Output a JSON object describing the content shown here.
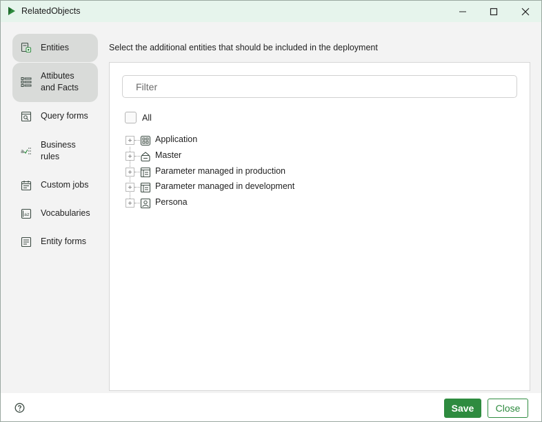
{
  "window": {
    "title": "RelatedObjects",
    "logo_icon": "app-logo-icon",
    "controls": {
      "minimize_icon": "minimize-icon",
      "maximize_icon": "maximize-icon",
      "close_icon": "close-window-icon"
    }
  },
  "sidebar": {
    "items": [
      {
        "label": "Entities",
        "icon": "entities-icon",
        "active": true
      },
      {
        "label": "Attibutes\nand Facts",
        "icon": "attributes-list-icon",
        "active": true
      },
      {
        "label": "Query forms",
        "icon": "query-form-icon",
        "active": false
      },
      {
        "label": "Business\nrules",
        "icon": "business-rules-icon",
        "active": false
      },
      {
        "label": "Custom jobs",
        "icon": "calendar-icon",
        "active": false
      },
      {
        "label": "Vocabularies",
        "icon": "vocabulary-icon",
        "active": false
      },
      {
        "label": "Entity forms",
        "icon": "entity-form-icon",
        "active": false
      }
    ]
  },
  "main": {
    "instruction": "Select the additional entities that should be included in the deployment",
    "filter": {
      "placeholder": "Filter",
      "value": ""
    },
    "all_label": "All",
    "tree": [
      {
        "label": "Application",
        "icon": "application-icon"
      },
      {
        "label": "Master",
        "icon": "master-icon"
      },
      {
        "label": "Parameter managed in production",
        "icon": "parameter-icon"
      },
      {
        "label": "Parameter managed in development",
        "icon": "parameter-icon"
      },
      {
        "label": "Persona",
        "icon": "persona-icon"
      }
    ]
  },
  "footer": {
    "help_icon": "help-icon",
    "save_label": "Save",
    "close_label": "Close"
  },
  "colors": {
    "accent": "#2e8b3f",
    "titlebar": "#e6f4ec",
    "active_nav": "#d9dbd9"
  }
}
